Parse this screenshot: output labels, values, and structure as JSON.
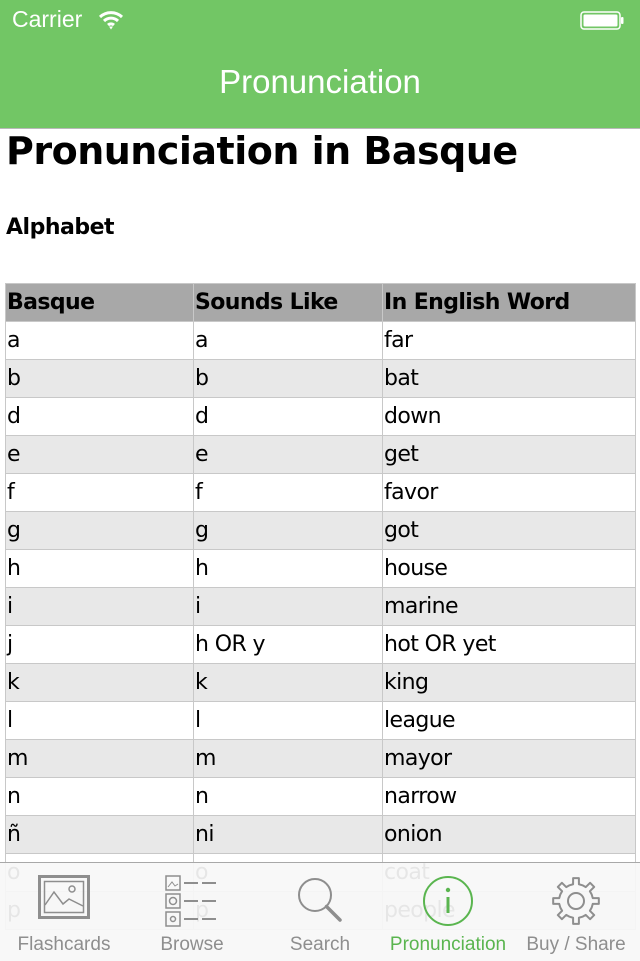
{
  "status_bar": {
    "carrier": "Carrier",
    "wifi_icon": "wifi-icon",
    "battery_icon": "battery-full-icon"
  },
  "nav": {
    "title": "Pronunciation",
    "bar_color": "#72c665"
  },
  "page": {
    "title": "Pronunciation in Basque",
    "section": "Alphabet"
  },
  "table": {
    "headers": [
      "Basque",
      "Sounds Like",
      "In English Word"
    ],
    "rows": [
      [
        "a",
        "a",
        "far"
      ],
      [
        "b",
        "b",
        "bat"
      ],
      [
        "d",
        "d",
        "down"
      ],
      [
        "e",
        "e",
        "get"
      ],
      [
        "f",
        "f",
        "favor"
      ],
      [
        "g",
        "g",
        "got"
      ],
      [
        "h",
        "h",
        "house"
      ],
      [
        "i",
        "i",
        "marine"
      ],
      [
        "j",
        "h OR y",
        "hot OR yet"
      ],
      [
        "k",
        "k",
        "king"
      ],
      [
        "l",
        "l",
        "league"
      ],
      [
        "m",
        "m",
        "mayor"
      ],
      [
        "n",
        "n",
        "narrow"
      ],
      [
        "ñ",
        "ni",
        "onion"
      ],
      [
        "o",
        "o",
        "coat"
      ],
      [
        "p",
        "p",
        "people"
      ]
    ]
  },
  "tabbar": {
    "active_color": "#5ab54f",
    "inactive_color": "#8e8e8e",
    "items": [
      {
        "label": "Flashcards",
        "icon": "flashcards-picture-icon",
        "active": false
      },
      {
        "label": "Browse",
        "icon": "browse-list-icon",
        "active": false
      },
      {
        "label": "Search",
        "icon": "search-icon",
        "active": false
      },
      {
        "label": "Pronunciation",
        "icon": "info-icon",
        "active": true
      },
      {
        "label": "Buy / Share",
        "icon": "gear-icon",
        "active": false
      }
    ]
  }
}
